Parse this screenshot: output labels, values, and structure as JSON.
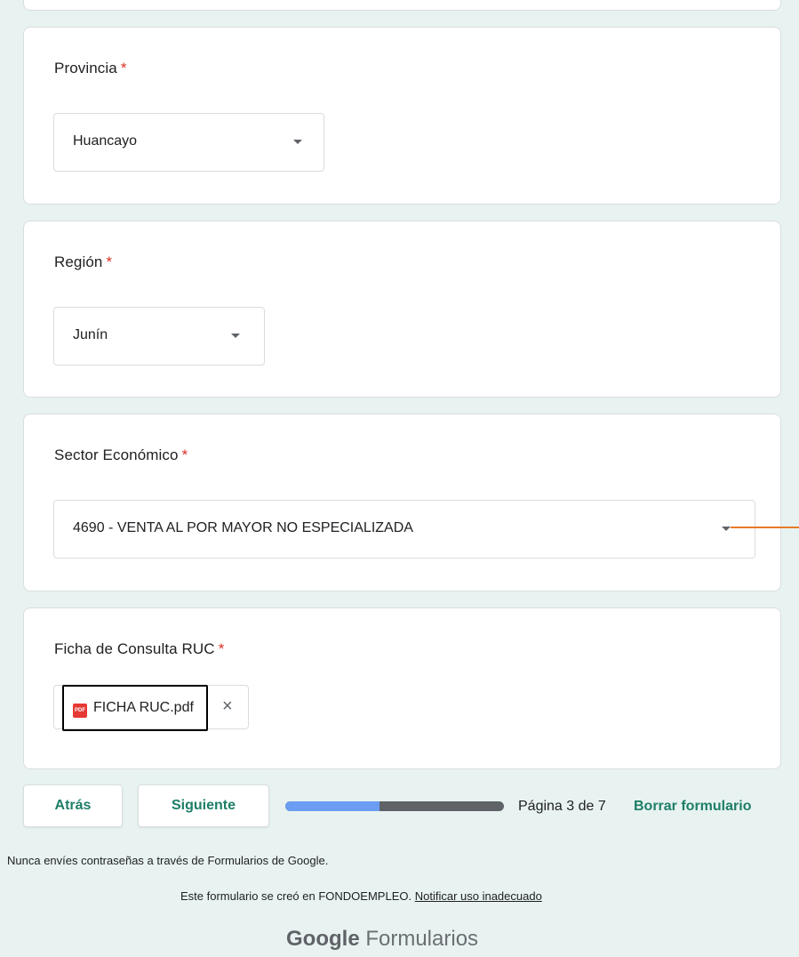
{
  "questions": {
    "provincia": {
      "title": "Provincia",
      "required_mark": "*",
      "value": "Huancayo"
    },
    "region": {
      "title": "Región",
      "required_mark": "*",
      "value": "Junín"
    },
    "sector": {
      "title": "Sector Económico",
      "required_mark": "*",
      "value": "4690 - VENTA AL POR MAYOR NO ESPECIALIZADA"
    },
    "ficha": {
      "title": "Ficha de Consulta RUC",
      "required_mark": "*",
      "file_icon_text": "PDF",
      "file_name": "FICHA RUC.pdf",
      "remove_glyph": "×"
    }
  },
  "navigation": {
    "back_label": "Atrás",
    "next_label": "Siguiente",
    "progress": 0.43,
    "page_label": "Página 3 de 7",
    "clear_label": "Borrar formulario"
  },
  "footer": {
    "password_note": "Nunca envíes contraseñas a través de Formularios de Google.",
    "created_text": "Este formulario se creó en FONDOEMPLEO.",
    "report_link": "Notificar uso inadecuado",
    "brand_google": "Google",
    "brand_forms": "Formularios"
  },
  "colors": {
    "accent": "#1e7e67",
    "required": "#d93025",
    "background": "#e8f3f1",
    "progress_fill": "#6b9df2",
    "annotation": "#e87b2a"
  }
}
